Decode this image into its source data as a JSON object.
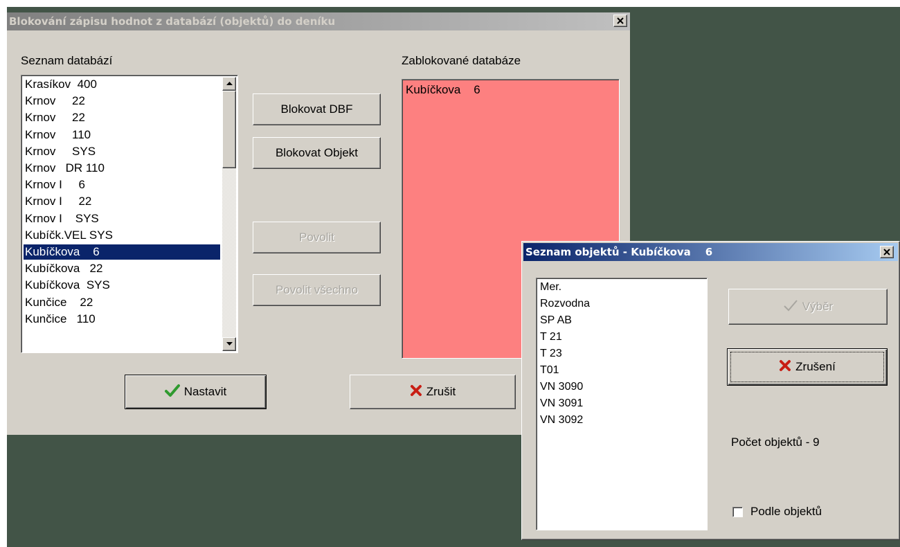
{
  "main_dialog": {
    "title": "Blokování zápisu hodnot z databází (objektů) do deníku",
    "databases_label": "Seznam databází",
    "databases": [
      "Krasíkov  400",
      "Krnov     22",
      "Krnov     22",
      "Krnov     110",
      "Krnov     SYS",
      "Krnov   DR 110",
      "Krnov I     6",
      "Krnov I     22",
      "Krnov I    SYS",
      "Kubíčk.VEL SYS",
      "Kubíčkova    6",
      "Kubíčkova   22",
      "Kubíčkova  SYS",
      "Kunčice    22",
      "Kunčice   110"
    ],
    "selected_database": "Kubíčkova    6",
    "blocked_label": "Zablokované databáze",
    "blocked": [
      "Kubíčkova    6"
    ],
    "buttons": {
      "block_dbf": "Blokovat DBF",
      "block_object": "Blokovat Objekt",
      "allow": "Povolit",
      "allow_all": "Povolit všechno",
      "set": "Nastavit",
      "cancel": "Zrušit"
    }
  },
  "objects_dialog": {
    "title": "Seznam objektů - Kubíčkova    6",
    "objects": [
      "Mer.",
      "Rozvodna",
      "SP AB",
      "T 21",
      "T 23",
      "T01",
      "VN 3090",
      "VN 3091",
      "VN 3092"
    ],
    "buttons": {
      "select": "Výběr",
      "cancel": "Zrušení"
    },
    "count_text": "Počet objektů - 9",
    "by_objects_label": "Podle objektů",
    "by_objects_checked": false
  },
  "colors": {
    "blocked_list_bg": "#fd8080",
    "selection": "#0a246a",
    "desktop": "#425447",
    "checkmark": "#2f9a2f",
    "cross": "#c81e14"
  }
}
